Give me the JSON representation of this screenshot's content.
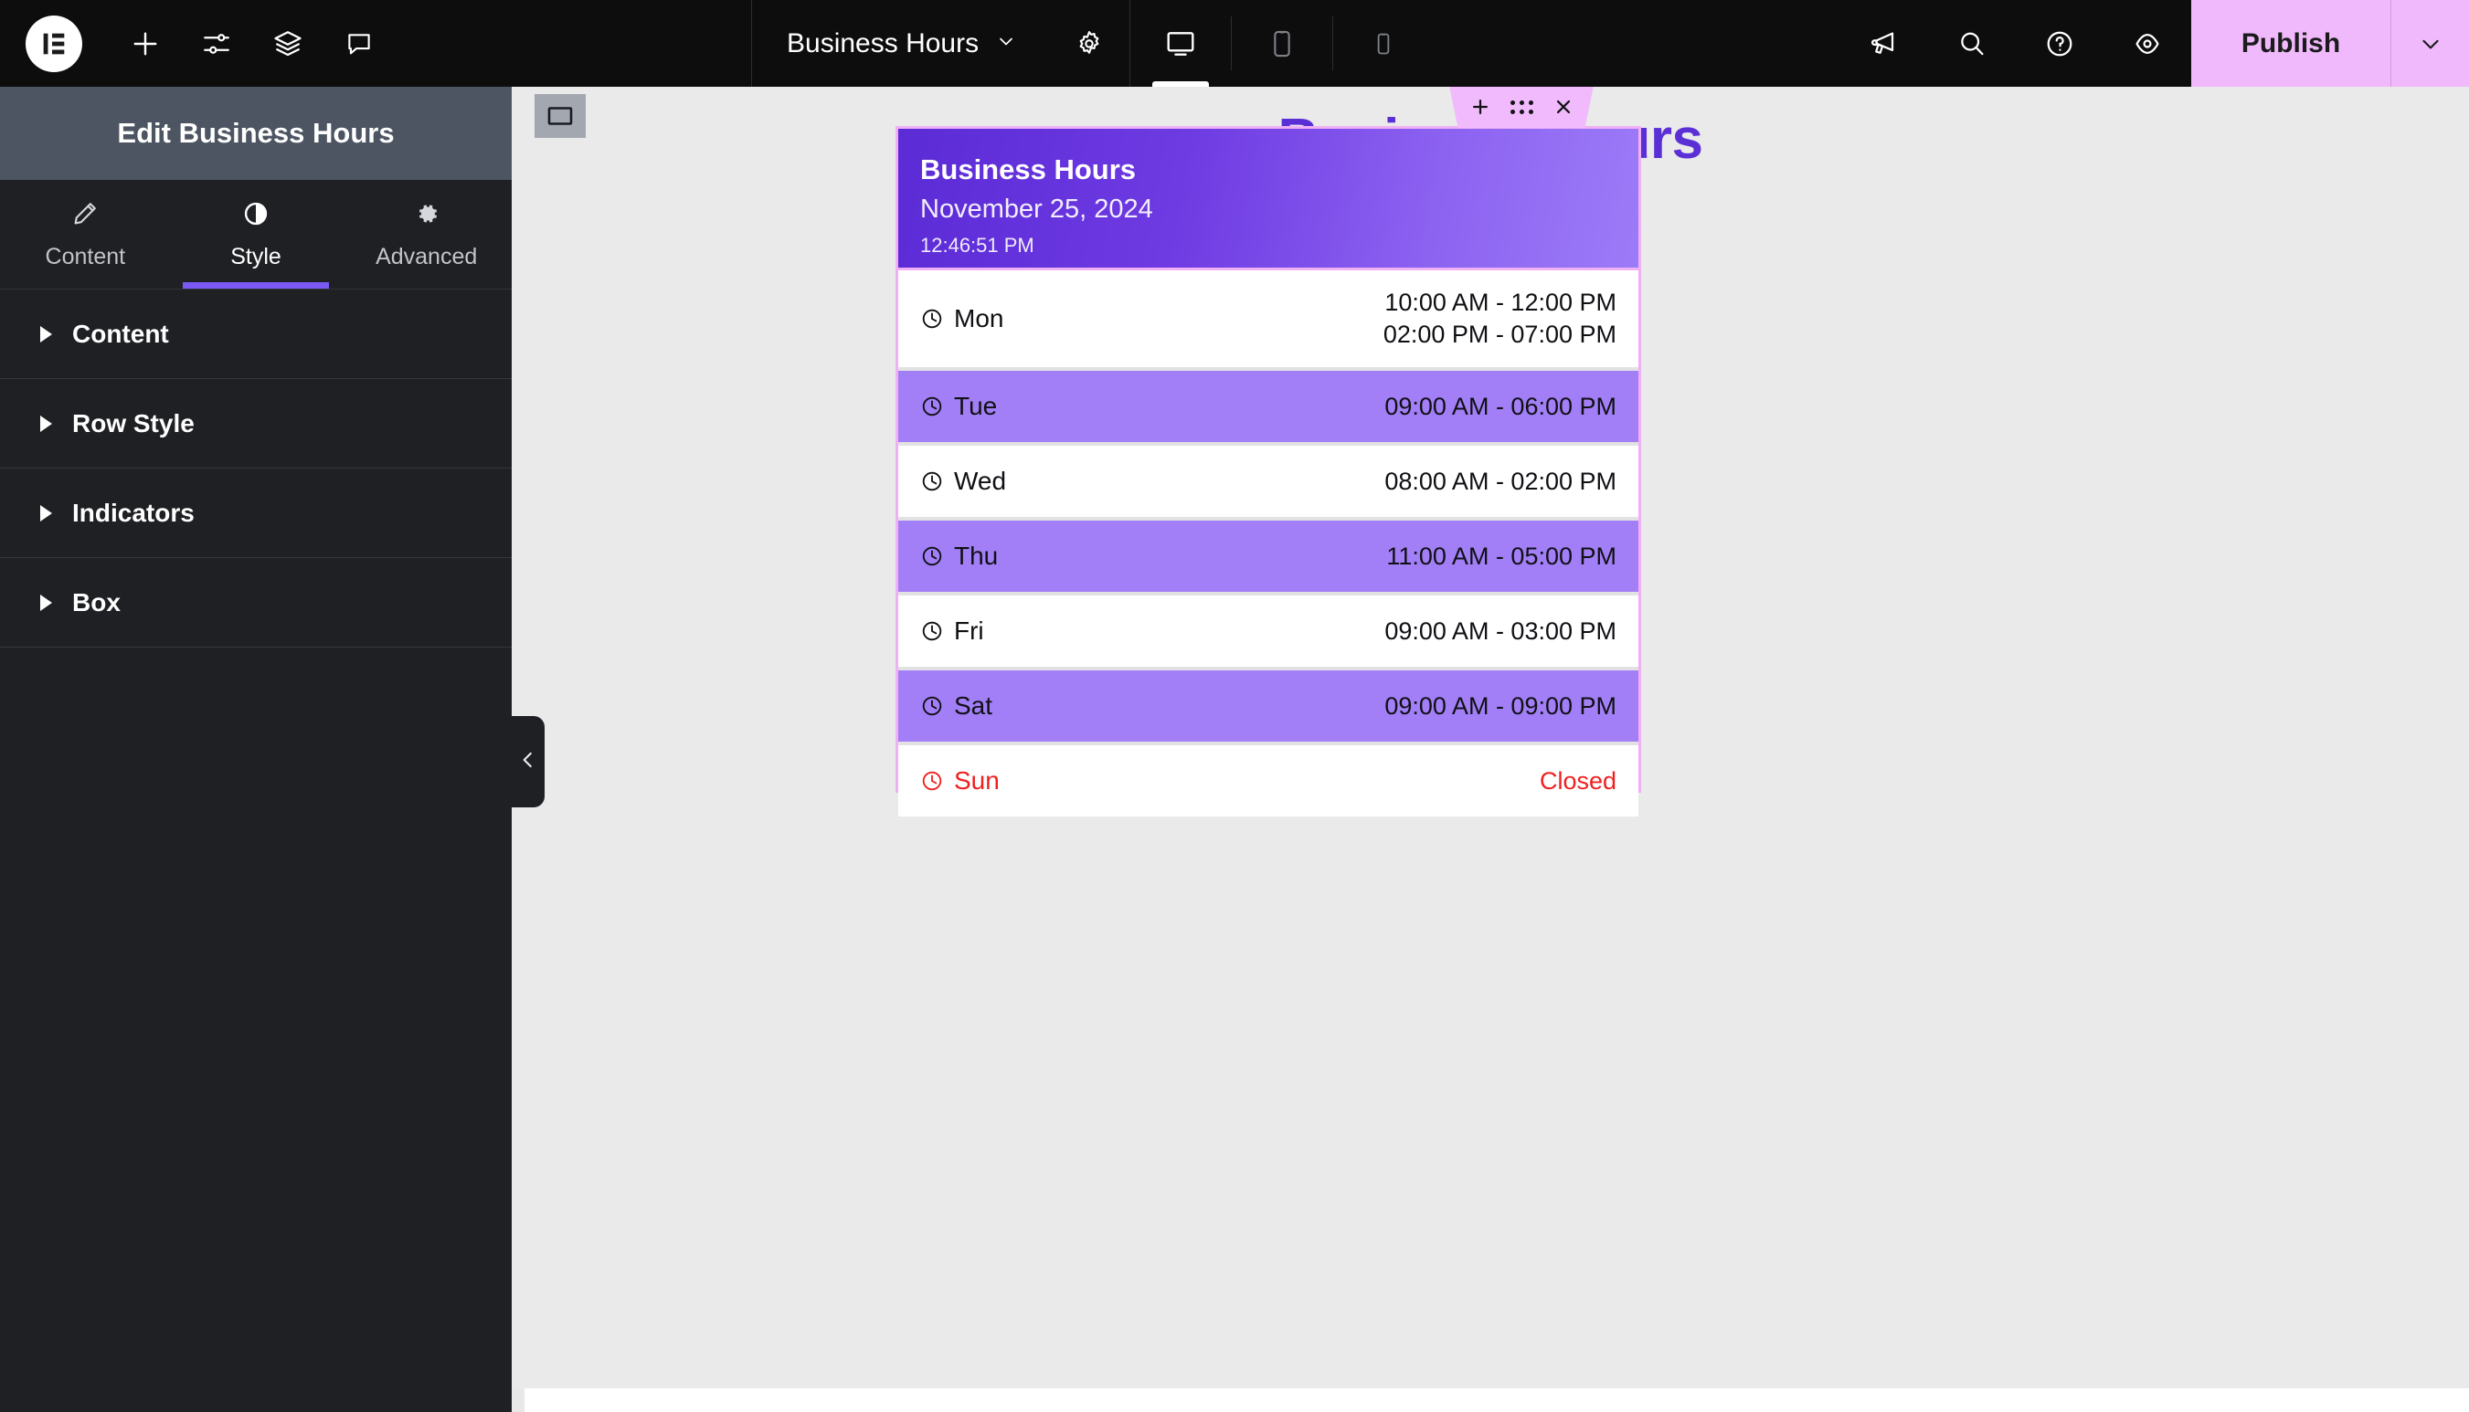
{
  "topbar": {
    "logo_icon": "elementor-logo-icon",
    "left_icons": [
      {
        "name": "add-element-icon",
        "glyph": "plus"
      },
      {
        "name": "site-settings-sliders-icon",
        "glyph": "sliders"
      },
      {
        "name": "structure-layers-icon",
        "glyph": "layers"
      },
      {
        "name": "notes-comment-icon",
        "glyph": "comment"
      }
    ],
    "document_name": "Business Hours",
    "document_caret_icon": "chevron-down-icon",
    "settings_icon": "gear-icon",
    "devices": [
      {
        "name": "desktop",
        "icon": "desktop-icon",
        "active": true
      },
      {
        "name": "tablet",
        "icon": "tablet-icon",
        "active": false
      },
      {
        "name": "mobile",
        "icon": "mobile-icon",
        "active": false
      }
    ],
    "right_icons": [
      {
        "name": "whats-new-megaphone-icon",
        "glyph": "megaphone"
      },
      {
        "name": "finder-search-icon",
        "glyph": "search"
      },
      {
        "name": "help-icon",
        "glyph": "question"
      },
      {
        "name": "preview-changes-eye-icon",
        "glyph": "eye"
      }
    ],
    "publish_label": "Publish",
    "publish_caret_icon": "chevron-down-icon",
    "publish_color": "#f0b9fb"
  },
  "panel": {
    "title": "Edit Business Hours",
    "tabs": [
      {
        "label": "Content",
        "icon": "pencil-icon",
        "active": false
      },
      {
        "label": "Style",
        "icon": "contrast-circle-icon",
        "active": true
      },
      {
        "label": "Advanced",
        "icon": "gear-icon",
        "active": false
      }
    ],
    "active_tab_color": "#7b59f5",
    "sections": [
      {
        "label": "Content"
      },
      {
        "label": "Row Style"
      },
      {
        "label": "Indicators"
      },
      {
        "label": "Box"
      }
    ],
    "collapse_icon": "chevron-left-icon"
  },
  "canvas": {
    "widget_handle_icon": "container-rectangle-icon",
    "page_title": "Business Hours",
    "page_title_color": "#5b2fd6",
    "float_toolbar": [
      {
        "name": "add-widget-button",
        "icon": "plus-icon"
      },
      {
        "name": "drag-handle",
        "icon": "grip-dots-icon"
      },
      {
        "name": "delete-widget-button",
        "icon": "close-x-icon"
      }
    ],
    "selection_border_color": "#f0b0f5"
  },
  "widget": {
    "header": {
      "title": "Business Hours",
      "date": "November 25, 2024",
      "time": "12:46:51 PM",
      "gradient_from": "#5b2bd6",
      "gradient_to": "#9c7bf7"
    },
    "row_alt_color": "#a27ff7",
    "closed_color": "#ef2020",
    "rows": [
      {
        "day": "Mon",
        "icon": "clock-icon",
        "times": [
          "10:00 AM - 12:00 PM",
          "02:00 PM - 07:00 PM"
        ],
        "alt": false,
        "closed": false
      },
      {
        "day": "Tue",
        "icon": "clock-icon",
        "times": [
          "09:00 AM - 06:00 PM"
        ],
        "alt": true,
        "closed": false
      },
      {
        "day": "Wed",
        "icon": "clock-icon",
        "times": [
          "08:00 AM - 02:00 PM"
        ],
        "alt": false,
        "closed": false
      },
      {
        "day": "Thu",
        "icon": "clock-icon",
        "times": [
          "11:00 AM - 05:00 PM"
        ],
        "alt": true,
        "closed": false
      },
      {
        "day": "Fri",
        "icon": "clock-icon",
        "times": [
          "09:00 AM - 03:00 PM"
        ],
        "alt": false,
        "closed": false
      },
      {
        "day": "Sat",
        "icon": "clock-icon",
        "times": [
          "09:00 AM - 09:00 PM"
        ],
        "alt": true,
        "closed": false
      },
      {
        "day": "Sun",
        "icon": "clock-icon",
        "times": [
          "Closed"
        ],
        "alt": false,
        "closed": true
      }
    ]
  }
}
